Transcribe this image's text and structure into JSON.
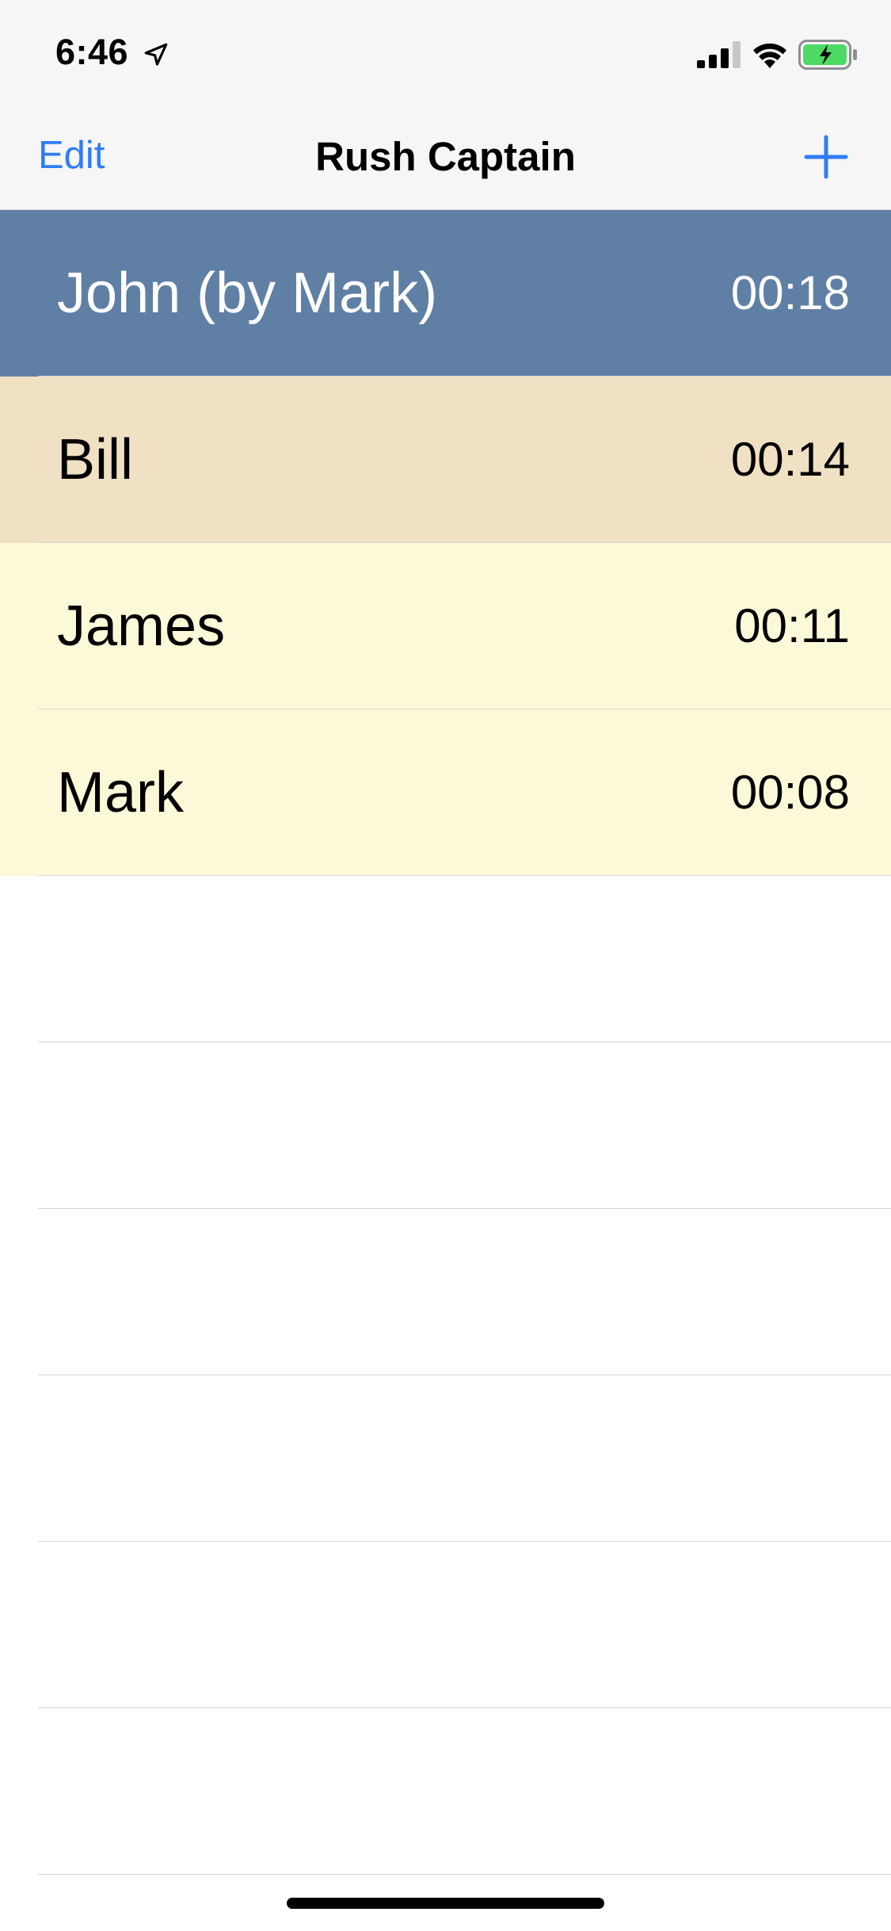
{
  "status_bar": {
    "time": "6:46",
    "icons": [
      "location-arrow-icon",
      "cellular-signal-icon",
      "wifi-icon",
      "battery-charging-icon"
    ],
    "battery_color": "#4cd964"
  },
  "nav": {
    "edit_label": "Edit",
    "title": "Rush Captain",
    "add_icon": "plus-icon",
    "accent_color": "#2f7cf6"
  },
  "rows": [
    {
      "name": "John (by Mark)",
      "time": "00:18",
      "bg": "#607fa5",
      "active": true
    },
    {
      "name": "Bill",
      "time": "00:14",
      "bg": "#f0e0c4",
      "active": false
    },
    {
      "name": "James",
      "time": "00:11",
      "bg": "#fcf9d8",
      "active": false
    },
    {
      "name": "Mark",
      "time": "00:08",
      "bg": "#fcf9d8",
      "active": false
    },
    {
      "name": "",
      "time": "",
      "bg": "#ffffff",
      "active": false
    },
    {
      "name": "",
      "time": "",
      "bg": "#ffffff",
      "active": false
    },
    {
      "name": "",
      "time": "",
      "bg": "#ffffff",
      "active": false
    },
    {
      "name": "",
      "time": "",
      "bg": "#ffffff",
      "active": false
    },
    {
      "name": "",
      "time": "",
      "bg": "#ffffff",
      "active": false
    },
    {
      "name": "",
      "time": "",
      "bg": "#ffffff",
      "active": false
    }
  ]
}
